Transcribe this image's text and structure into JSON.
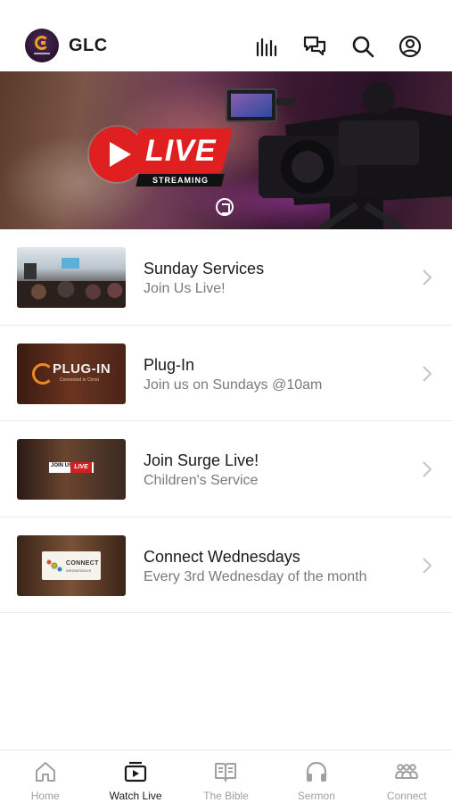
{
  "header": {
    "title": "GLC",
    "icons": [
      "stats-bars-icon",
      "chat-bubbles-icon",
      "search-icon",
      "profile-icon"
    ]
  },
  "banner": {
    "live_text": "LIVE",
    "streaming_text": "STREAMING"
  },
  "items": [
    {
      "title": "Sunday Services",
      "subtitle": "Join Us Live!"
    },
    {
      "title": "Plug-In",
      "subtitle": "Join us on Sundays @10am",
      "thumb_text": "PLUG-IN",
      "thumb_sub": "Connected in Christ"
    },
    {
      "title": "Join Surge Live!",
      "subtitle": "Children's Service",
      "thumb_text": "JOIN US",
      "thumb_badge": "LIVE"
    },
    {
      "title": "Connect Wednesdays",
      "subtitle": "Every 3rd Wednesday of the month",
      "thumb_text": "CONNECT",
      "thumb_sub": "WEDNESDAYS"
    }
  ],
  "tabs": [
    {
      "label": "Home",
      "icon": "home-icon"
    },
    {
      "label": "Watch Live",
      "icon": "play-screen-icon"
    },
    {
      "label": "The Bible",
      "icon": "open-book-icon"
    },
    {
      "label": "Sermon",
      "icon": "headphones-icon"
    },
    {
      "label": "Connect",
      "icon": "group-icon"
    }
  ],
  "active_tab": "Watch Live",
  "colors": {
    "live_red": "#e02020",
    "active_tab": "#1a1a1a",
    "inactive_tab": "#a0a0a0",
    "subtitle_gray": "#7a7a7a"
  }
}
